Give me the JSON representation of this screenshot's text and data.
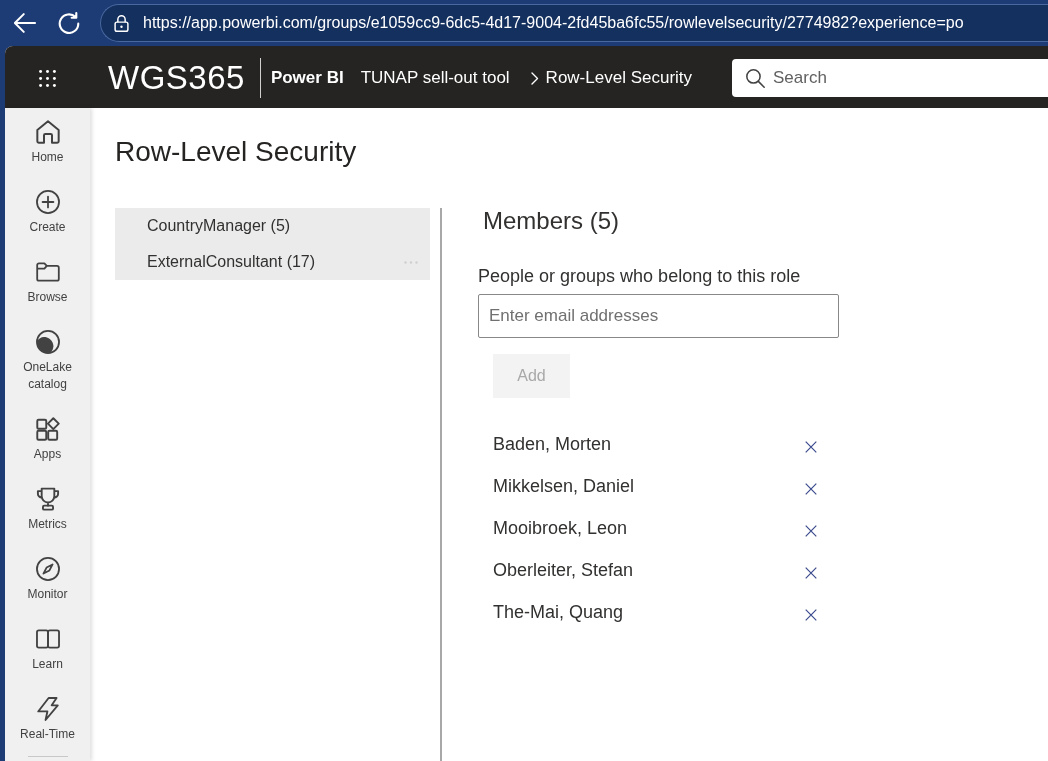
{
  "browser": {
    "url": "https://app.powerbi.com/groups/e1059cc9-6dc5-4d17-9004-2fd45ba6fc55/rowlevelsecurity/2774982?experience=po"
  },
  "header": {
    "logo": "WGS365",
    "product": "Power BI",
    "breadcrumbs": [
      "TUNAP sell-out tool",
      "Row-Level Security"
    ],
    "search": {
      "placeholder": "Search"
    }
  },
  "nav": {
    "items": [
      {
        "kind": "home",
        "label": "Home"
      },
      {
        "kind": "create",
        "label": "Create"
      },
      {
        "kind": "browse",
        "label": "Browse"
      },
      {
        "kind": "catalog",
        "label": "OneLake catalog"
      },
      {
        "kind": "apps",
        "label": "Apps"
      },
      {
        "kind": "metrics",
        "label": "Metrics"
      },
      {
        "kind": "monitor",
        "label": "Monitor"
      },
      {
        "kind": "learn",
        "label": "Learn"
      },
      {
        "kind": "realtime",
        "label": "Real-Time"
      }
    ]
  },
  "page": {
    "title": "Row-Level Security"
  },
  "roles": [
    {
      "label": "CountryManager (5)",
      "hovered": false
    },
    {
      "label": "ExternalConsultant (17)",
      "hovered": true
    }
  ],
  "members": {
    "title": "Members (5)",
    "field_label": "People or groups who belong to this role",
    "field": {
      "placeholder": "Enter email addresses"
    },
    "add_button": {
      "label": "Add",
      "disabled": true
    },
    "list": [
      {
        "name": "Baden, Morten"
      },
      {
        "name": "Mikkelsen, Daniel"
      },
      {
        "name": "Mooibroek, Leon"
      },
      {
        "name": "Oberleiter, Stefan"
      },
      {
        "name": "The-Mai, Quang"
      }
    ]
  }
}
